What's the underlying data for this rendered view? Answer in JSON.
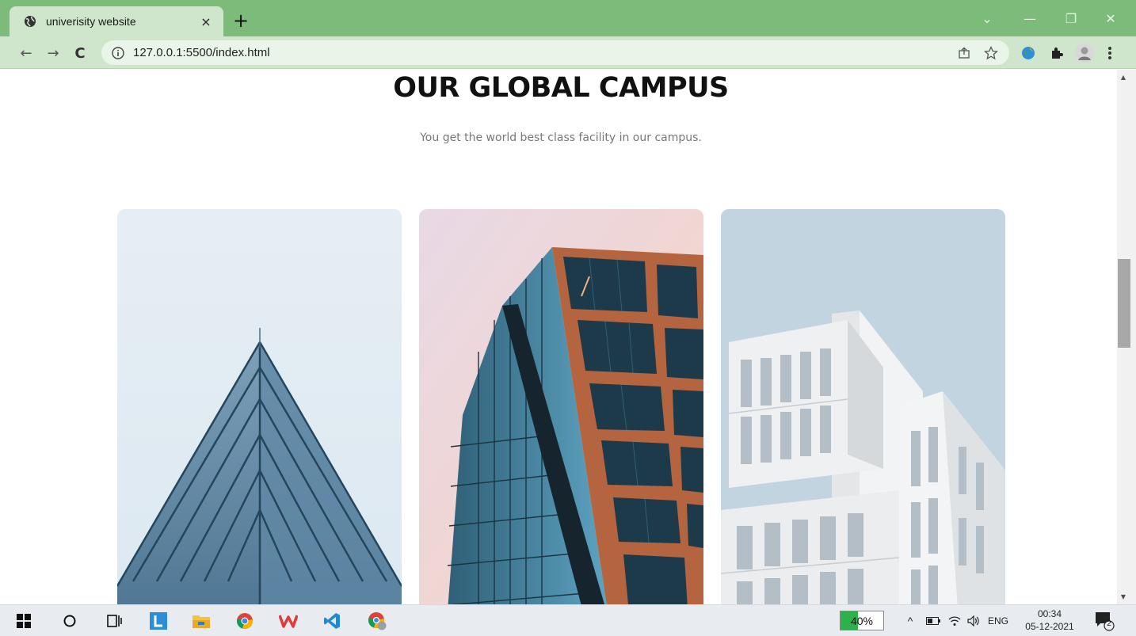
{
  "browser": {
    "tab_title": "univerisity website",
    "tab_close": "×",
    "new_tab": "+",
    "url": "127.0.0.1:5500/index.html",
    "window_controls": {
      "dropdown": "⌄",
      "minimize": "—",
      "restore": "❐",
      "close": "✕"
    },
    "nav": {
      "back": "←",
      "forward": "→",
      "reload": "C"
    },
    "omnibox_icons": [
      "share-icon",
      "bookmark-star-icon"
    ],
    "extensions": [
      "extension-globe-icon",
      "extensions-puzzle-icon",
      "profile-avatar-icon",
      "menu-dots-icon"
    ]
  },
  "page": {
    "heading": "OUR GLOBAL CAMPUS",
    "subtitle": "You get the world best class facility in our campus.",
    "campus_cards": [
      {
        "name": "glass-triangle-building"
      },
      {
        "name": "copper-glass-tower"
      },
      {
        "name": "white-modern-building"
      }
    ]
  },
  "taskbar": {
    "icons": [
      "windows-start-icon",
      "search-circle-icon",
      "task-view-icon",
      "l-app-icon",
      "file-explorer-icon",
      "chrome-icon",
      "wps-office-icon",
      "vscode-icon",
      "chrome-profile-icon"
    ],
    "battery_percent": 40,
    "battery_label": "40%",
    "tray_chevron": "^",
    "language": "ENG",
    "time": "00:34",
    "date": "05-12-2021",
    "notification_count": "2"
  },
  "colors": {
    "tab_bar": "#7dbb7a",
    "toolbar": "#cfe6cc",
    "omnibox": "#eaf5e9",
    "battery_green": "#2bb24c"
  }
}
